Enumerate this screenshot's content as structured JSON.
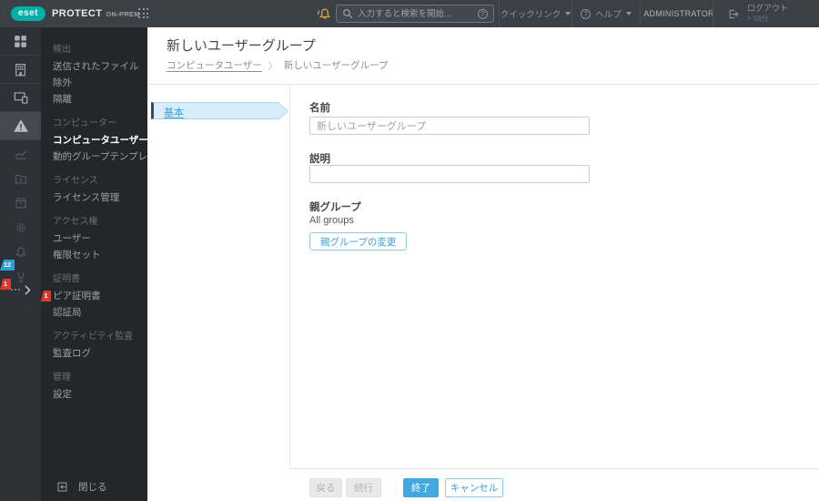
{
  "topbar": {
    "logo": "eset",
    "product_name": "PROTECT",
    "product_edition": "ON-PREM",
    "search_placeholder": "入力すると検索を開始...",
    "help_glyph": "?",
    "quick_links_label": "クイックリンク",
    "help_label": "ヘルプ",
    "user_name": "ADMINISTRATOR",
    "logout_label": "ログアウト",
    "session_timer": "> 59分"
  },
  "icon_rail": {
    "notification_badge": "12",
    "more_badge": "1"
  },
  "menu": {
    "items": [
      {
        "type": "header",
        "label": "検出"
      },
      {
        "type": "item",
        "label": "送信されたファイル"
      },
      {
        "type": "item",
        "label": "除外"
      },
      {
        "type": "item",
        "label": "隔離"
      },
      {
        "type": "header",
        "label": "コンピューター"
      },
      {
        "type": "item",
        "label": "コンピュータユーザー",
        "active": true
      },
      {
        "type": "item",
        "label": "動的グループテンプレート"
      },
      {
        "type": "header",
        "label": "ライセンス"
      },
      {
        "type": "item",
        "label": "ライセンス管理"
      },
      {
        "type": "header",
        "label": "アクセス権"
      },
      {
        "type": "item",
        "label": "ユーザー"
      },
      {
        "type": "item",
        "label": "権限セット"
      },
      {
        "type": "header",
        "label": "証明書"
      },
      {
        "type": "item",
        "label": "ピア証明書",
        "badge": "1"
      },
      {
        "type": "item",
        "label": "認証局"
      },
      {
        "type": "header",
        "label": "アクティビティ監査"
      },
      {
        "type": "item",
        "label": "監査ログ"
      },
      {
        "type": "header",
        "label": "管理"
      },
      {
        "type": "item",
        "label": "設定"
      }
    ],
    "collapse_label": "閉じる"
  },
  "page": {
    "title": "新しいユーザーグループ",
    "breadcrumb_parent": "コンピュータユーザー",
    "breadcrumb_separator": "〉",
    "breadcrumb_current": "新しいユーザーグループ"
  },
  "wizard": {
    "step_label": "基本"
  },
  "form": {
    "name_label": "名前",
    "name_value": "新しいユーザーグループ",
    "description_label": "説明",
    "description_value": "",
    "parent_label": "親グループ",
    "parent_value": "All groups",
    "change_parent_button": "親グループの変更"
  },
  "footer": {
    "back_label": "戻る",
    "continue_label": "続行",
    "finish_label": "終了",
    "cancel_label": "キャンセル"
  },
  "colors": {
    "accent_blue": "#3b9fd8",
    "eset_teal": "#00afa8",
    "badge_red": "#e2362c",
    "badge_blue": "#2d9fd8",
    "bell_amber": "#d9a23a",
    "topbar_bg": "#3a4046",
    "rail_bg": "#2c3137",
    "panel_bg": "#23272c"
  }
}
